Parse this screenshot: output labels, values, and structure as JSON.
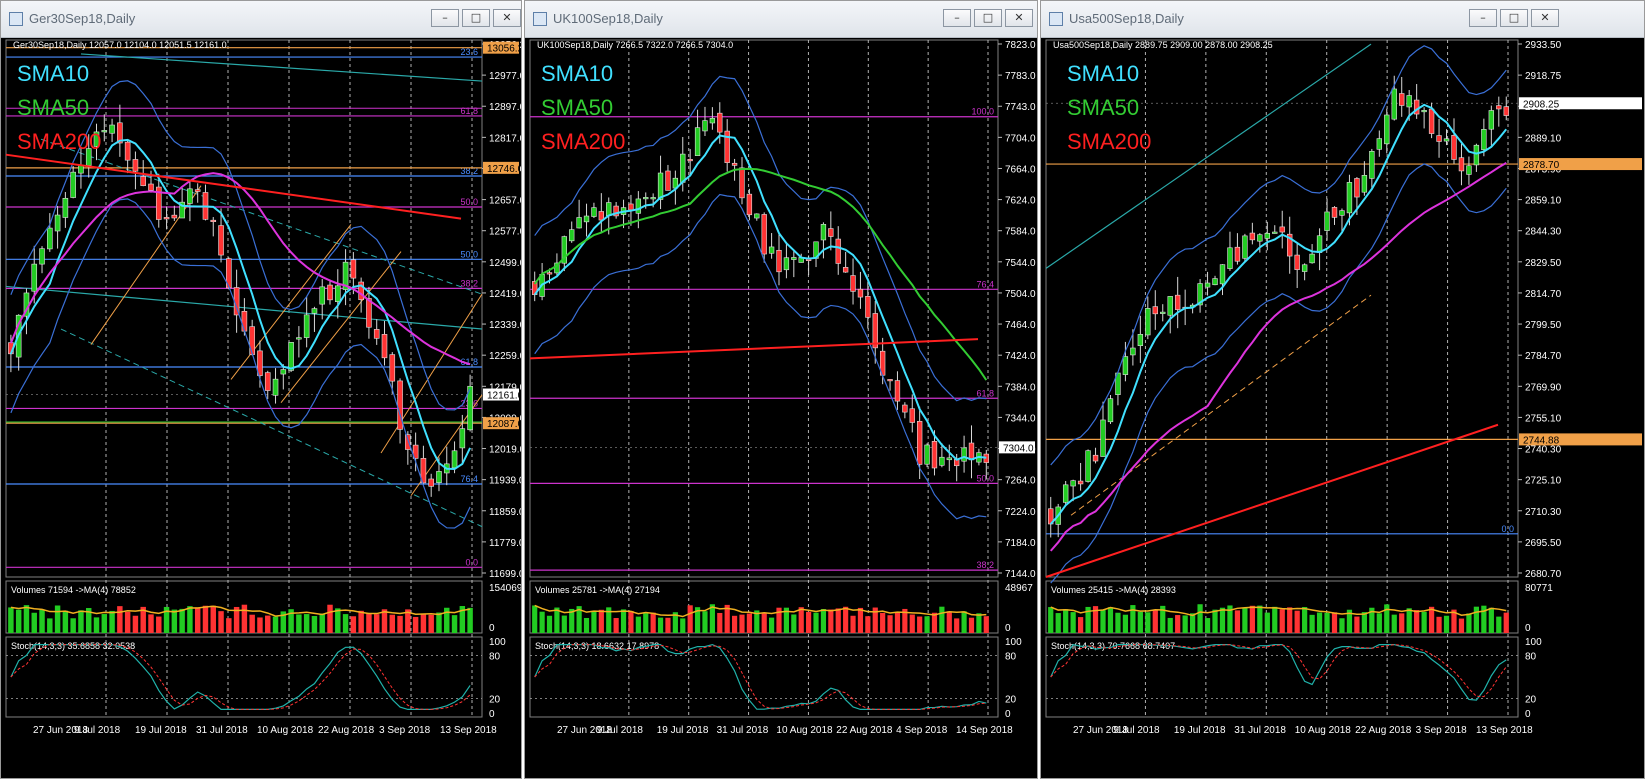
{
  "windows": [
    {
      "title": "Ger30Sep18,Daily",
      "header": "Ger30Sep18,Daily  12057.0 12104.0 12051.5 12161.0",
      "legend": [
        "SMA10",
        "SMA50",
        "SMA200"
      ],
      "price_axis": [
        "13056.2",
        "12977.0",
        "12897.0",
        "12817.0",
        "12737.0",
        "12657.0",
        "12577.0",
        "12499.0",
        "12419.0",
        "12339.0",
        "12259.0",
        "12179.0",
        "12099.0",
        "12019.0",
        "11939.0",
        "11859.0",
        "11779.0",
        "11699.0"
      ],
      "price_tags": [
        {
          "text": "13056.2",
          "price": 13056.2,
          "color": "#f0a048"
        },
        {
          "text": "12746.0",
          "price": 12746.0,
          "color": "#f0a048"
        },
        {
          "text": "12161.0",
          "price": 12161.0,
          "color": "#ffffff"
        },
        {
          "text": "12087.0",
          "price": 12087.0,
          "color": "#f0a048"
        }
      ],
      "fib_labels": [
        {
          "text": "23.6",
          "price": 13032,
          "color": "#4a8cff"
        },
        {
          "text": "61.8",
          "price": 12880,
          "color": "#cc33cc"
        },
        {
          "text": "38.2",
          "price": 12725,
          "color": "#4a8cff"
        },
        {
          "text": "50.0",
          "price": 12645,
          "color": "#cc33cc"
        },
        {
          "text": "50.0",
          "price": 12510,
          "color": "#4a8cff"
        },
        {
          "text": "38.2",
          "price": 12435,
          "color": "#cc33cc"
        },
        {
          "text": "61.8",
          "price": 12232,
          "color": "#4a8cff"
        },
        {
          "text": "23.6",
          "price": 12125,
          "color": "#cc33cc"
        },
        {
          "text": "76.4",
          "price": 11930,
          "color": "#4a8cff"
        },
        {
          "text": "0.0",
          "price": 11715,
          "color": "#cc33cc"
        }
      ],
      "volume_header": "Volumes 71594  ->MA(4) 78852",
      "volume_axis": [
        "154069",
        "0"
      ],
      "stoch_header": "Stoch(14,3,3) 35.6858 32.0538",
      "stoch_axis": [
        "100",
        "80",
        "20",
        "0"
      ],
      "dates": [
        "27 Jun 2018",
        "9 Jul 2018",
        "19 Jul 2018",
        "31 Jul 2018",
        "10 Aug 2018",
        "22 Aug 2018",
        "3 Sep 2018",
        "13 Sep 2018"
      ]
    },
    {
      "title": "UK100Sep18,Daily",
      "header": "UK100Sep18,Daily  7266.5 7322.0 7266.5 7304.0",
      "legend": [
        "SMA10",
        "SMA50",
        "SMA200"
      ],
      "price_axis": [
        "7823.0",
        "7783.0",
        "7743.0",
        "7704.0",
        "7664.0",
        "7624.0",
        "7584.0",
        "7544.0",
        "7504.0",
        "7464.0",
        "7424.0",
        "7384.0",
        "7344.0",
        "7304.0",
        "7264.0",
        "7224.0",
        "7184.0",
        "7144.0"
      ],
      "price_tags": [
        {
          "text": "7304.0",
          "price": 7304.0,
          "color": "#ffffff"
        }
      ],
      "fib_labels": [
        {
          "text": "100.0",
          "price": 7735,
          "color": "#cc33cc"
        },
        {
          "text": "76.4",
          "price": 7510,
          "color": "#cc33cc"
        },
        {
          "text": "61.8",
          "price": 7368,
          "color": "#cc33cc"
        },
        {
          "text": "50.0",
          "price": 7257,
          "color": "#cc33cc"
        },
        {
          "text": "38.2",
          "price": 7144,
          "color": "#cc33cc"
        }
      ],
      "volume_header": "Volumes 25781  ->MA(4) 27194",
      "volume_axis": [
        "48967",
        "0"
      ],
      "stoch_header": "Stoch(14,3,3) 18.6632 17.8978",
      "stoch_axis": [
        "100",
        "80",
        "20",
        "0"
      ],
      "dates": [
        "27 Jun 2018",
        "9 Jul 2018",
        "19 Jul 2018",
        "31 Jul 2018",
        "10 Aug 2018",
        "22 Aug 2018",
        "4 Sep 2018",
        "14 Sep 2018"
      ]
    },
    {
      "title": "Usa500Sep18,Daily",
      "header": "Usa500Sep18,Daily  2889.75 2909.00 2878.00 2908.25",
      "legend": [
        "SMA10",
        "SMA50",
        "SMA200"
      ],
      "price_axis": [
        "2933.50",
        "2918.75",
        "2903.90",
        "2889.10",
        "2873.90",
        "2859.10",
        "2844.30",
        "2829.50",
        "2814.70",
        "2799.50",
        "2784.70",
        "2769.90",
        "2755.10",
        "2740.30",
        "2725.10",
        "2710.30",
        "2695.50",
        "2680.70"
      ],
      "price_tags": [
        {
          "text": "2908.25",
          "price": 2908.25,
          "color": "#ffffff"
        },
        {
          "text": "2878.70",
          "price": 2878.7,
          "color": "#f0a048"
        },
        {
          "text": "2744.88",
          "price": 2744.88,
          "color": "#f0a048"
        }
      ],
      "fib_labels": [
        {
          "text": "0.0",
          "price": 2699,
          "color": "#4a8cff"
        }
      ],
      "volume_header": "Volumes 25415  ->MA(4) 28393",
      "volume_axis": [
        "80771",
        "0"
      ],
      "stoch_header": "Stoch(14,3,3) 70.7668 68.7407",
      "stoch_axis": [
        "100",
        "80",
        "20",
        "0"
      ],
      "dates": [
        "27 Jun 2018",
        "9 Jul 2018",
        "19 Jul 2018",
        "31 Jul 2018",
        "10 Aug 2018",
        "22 Aug 2018",
        "3 Sep 2018",
        "13 Sep 2018"
      ]
    }
  ],
  "window_buttons": {
    "minimize": "–",
    "maximize": "□",
    "close": "✕"
  },
  "colors": {
    "sma10": "#40e0ff",
    "sma50": "#33cc33",
    "sma200": "#ff2020",
    "bull": "#22cc22",
    "bear": "#ff3333",
    "orange": "#f0a048",
    "fibBlue": "#4a8cff",
    "fibMagenta": "#cc33cc"
  }
}
